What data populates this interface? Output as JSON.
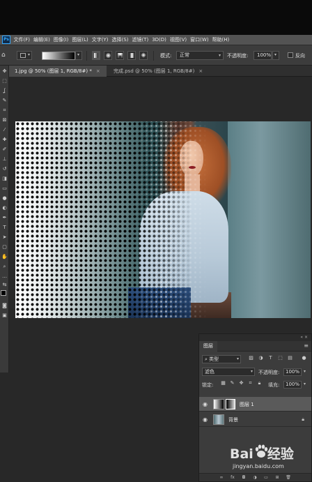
{
  "menubar": {
    "app_badge": "Ps",
    "items": [
      "文件(F)",
      "编辑(E)",
      "图像(I)",
      "图层(L)",
      "文字(Y)",
      "选择(S)",
      "滤镜(T)",
      "3D(D)",
      "视图(V)",
      "窗口(W)",
      "帮助(H)"
    ]
  },
  "options": {
    "mode_label": "模式:",
    "mode_value": "正常",
    "opacity_label": "不透明度:",
    "opacity_value": "100%",
    "reverse_label": "反向"
  },
  "tabs": [
    {
      "label": "1.jpg @ 50% (图层 1, RGB/8#) *",
      "close": "×",
      "active": true
    },
    {
      "label": "完成.psd @ 50% (图层 1, RGB/8#)",
      "close": "×",
      "active": false
    }
  ],
  "layers_panel": {
    "tab_label": "图层",
    "filter_kind": "类型",
    "blend_mode": "滤色",
    "opacity_label": "不透明度:",
    "opacity_value": "100%",
    "lock_label": "锁定:",
    "fill_label": "填充:",
    "fill_value": "100%",
    "layers": [
      {
        "name": "图层 1",
        "selected": true
      },
      {
        "name": "背景",
        "selected": false,
        "locked": true
      }
    ]
  },
  "watermark": {
    "logo_left": "Bai",
    "logo_right": "经验",
    "url": "jingyan.baidu.com"
  },
  "colors": {
    "accent": "#31a8ff",
    "panel_bg": "#3c3c3c",
    "workspace_bg": "#282828"
  },
  "icons": {
    "eye": "eye-icon",
    "lock": "lock-icon",
    "menu": "panel-menu-icon"
  }
}
